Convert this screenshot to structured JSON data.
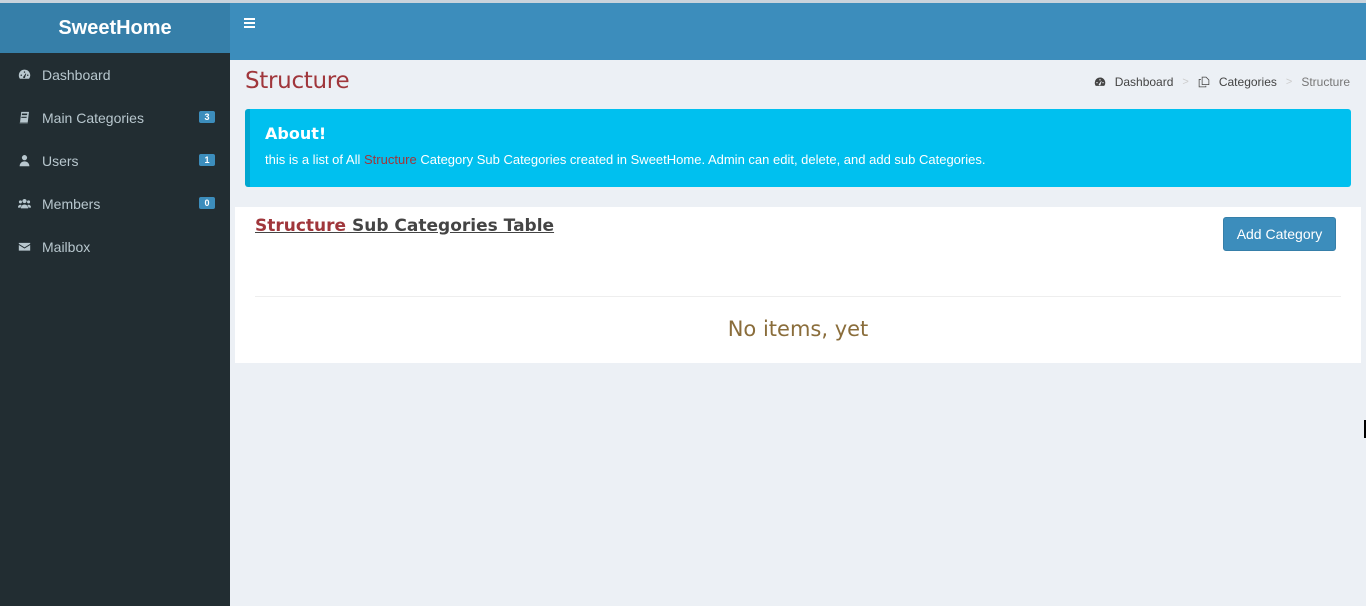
{
  "app": {
    "brand": "SweetHome"
  },
  "sidebar": {
    "items": [
      {
        "label": "Dashboard",
        "icon": "dashboard-icon",
        "badge": null
      },
      {
        "label": "Main Categories",
        "icon": "book-icon",
        "badge": "3"
      },
      {
        "label": "Users",
        "icon": "user-icon",
        "badge": "1"
      },
      {
        "label": "Members",
        "icon": "users-icon",
        "badge": "0"
      },
      {
        "label": "Mailbox",
        "icon": "envelope-icon",
        "badge": null
      }
    ]
  },
  "header": {
    "toggle_icon": "hamburger-icon"
  },
  "page": {
    "title": "Structure",
    "breadcrumb": [
      {
        "label": "Dashboard",
        "icon": "dashboard-icon"
      },
      {
        "label": "Categories",
        "icon": "copy-icon"
      },
      {
        "label": "Structure"
      }
    ],
    "separator": ">"
  },
  "callout": {
    "title": "About!",
    "text_before": "this is a list of All ",
    "highlight": "Structure",
    "text_after": " Category Sub Categories created in SweetHome. Admin can edit, delete, and add sub Categories."
  },
  "box": {
    "title_highlight": "Structure",
    "title_rest": " Sub Categories Table",
    "add_button": "Add Category",
    "empty_message": "No items, yet"
  },
  "colors": {
    "sidebar_bg": "#222d32",
    "header_bg": "#3c8dbc",
    "logo_bg": "#367fa9",
    "callout_bg": "#00c0ef",
    "accent_red": "#a0363b",
    "empty_text": "#8a6d3b"
  }
}
